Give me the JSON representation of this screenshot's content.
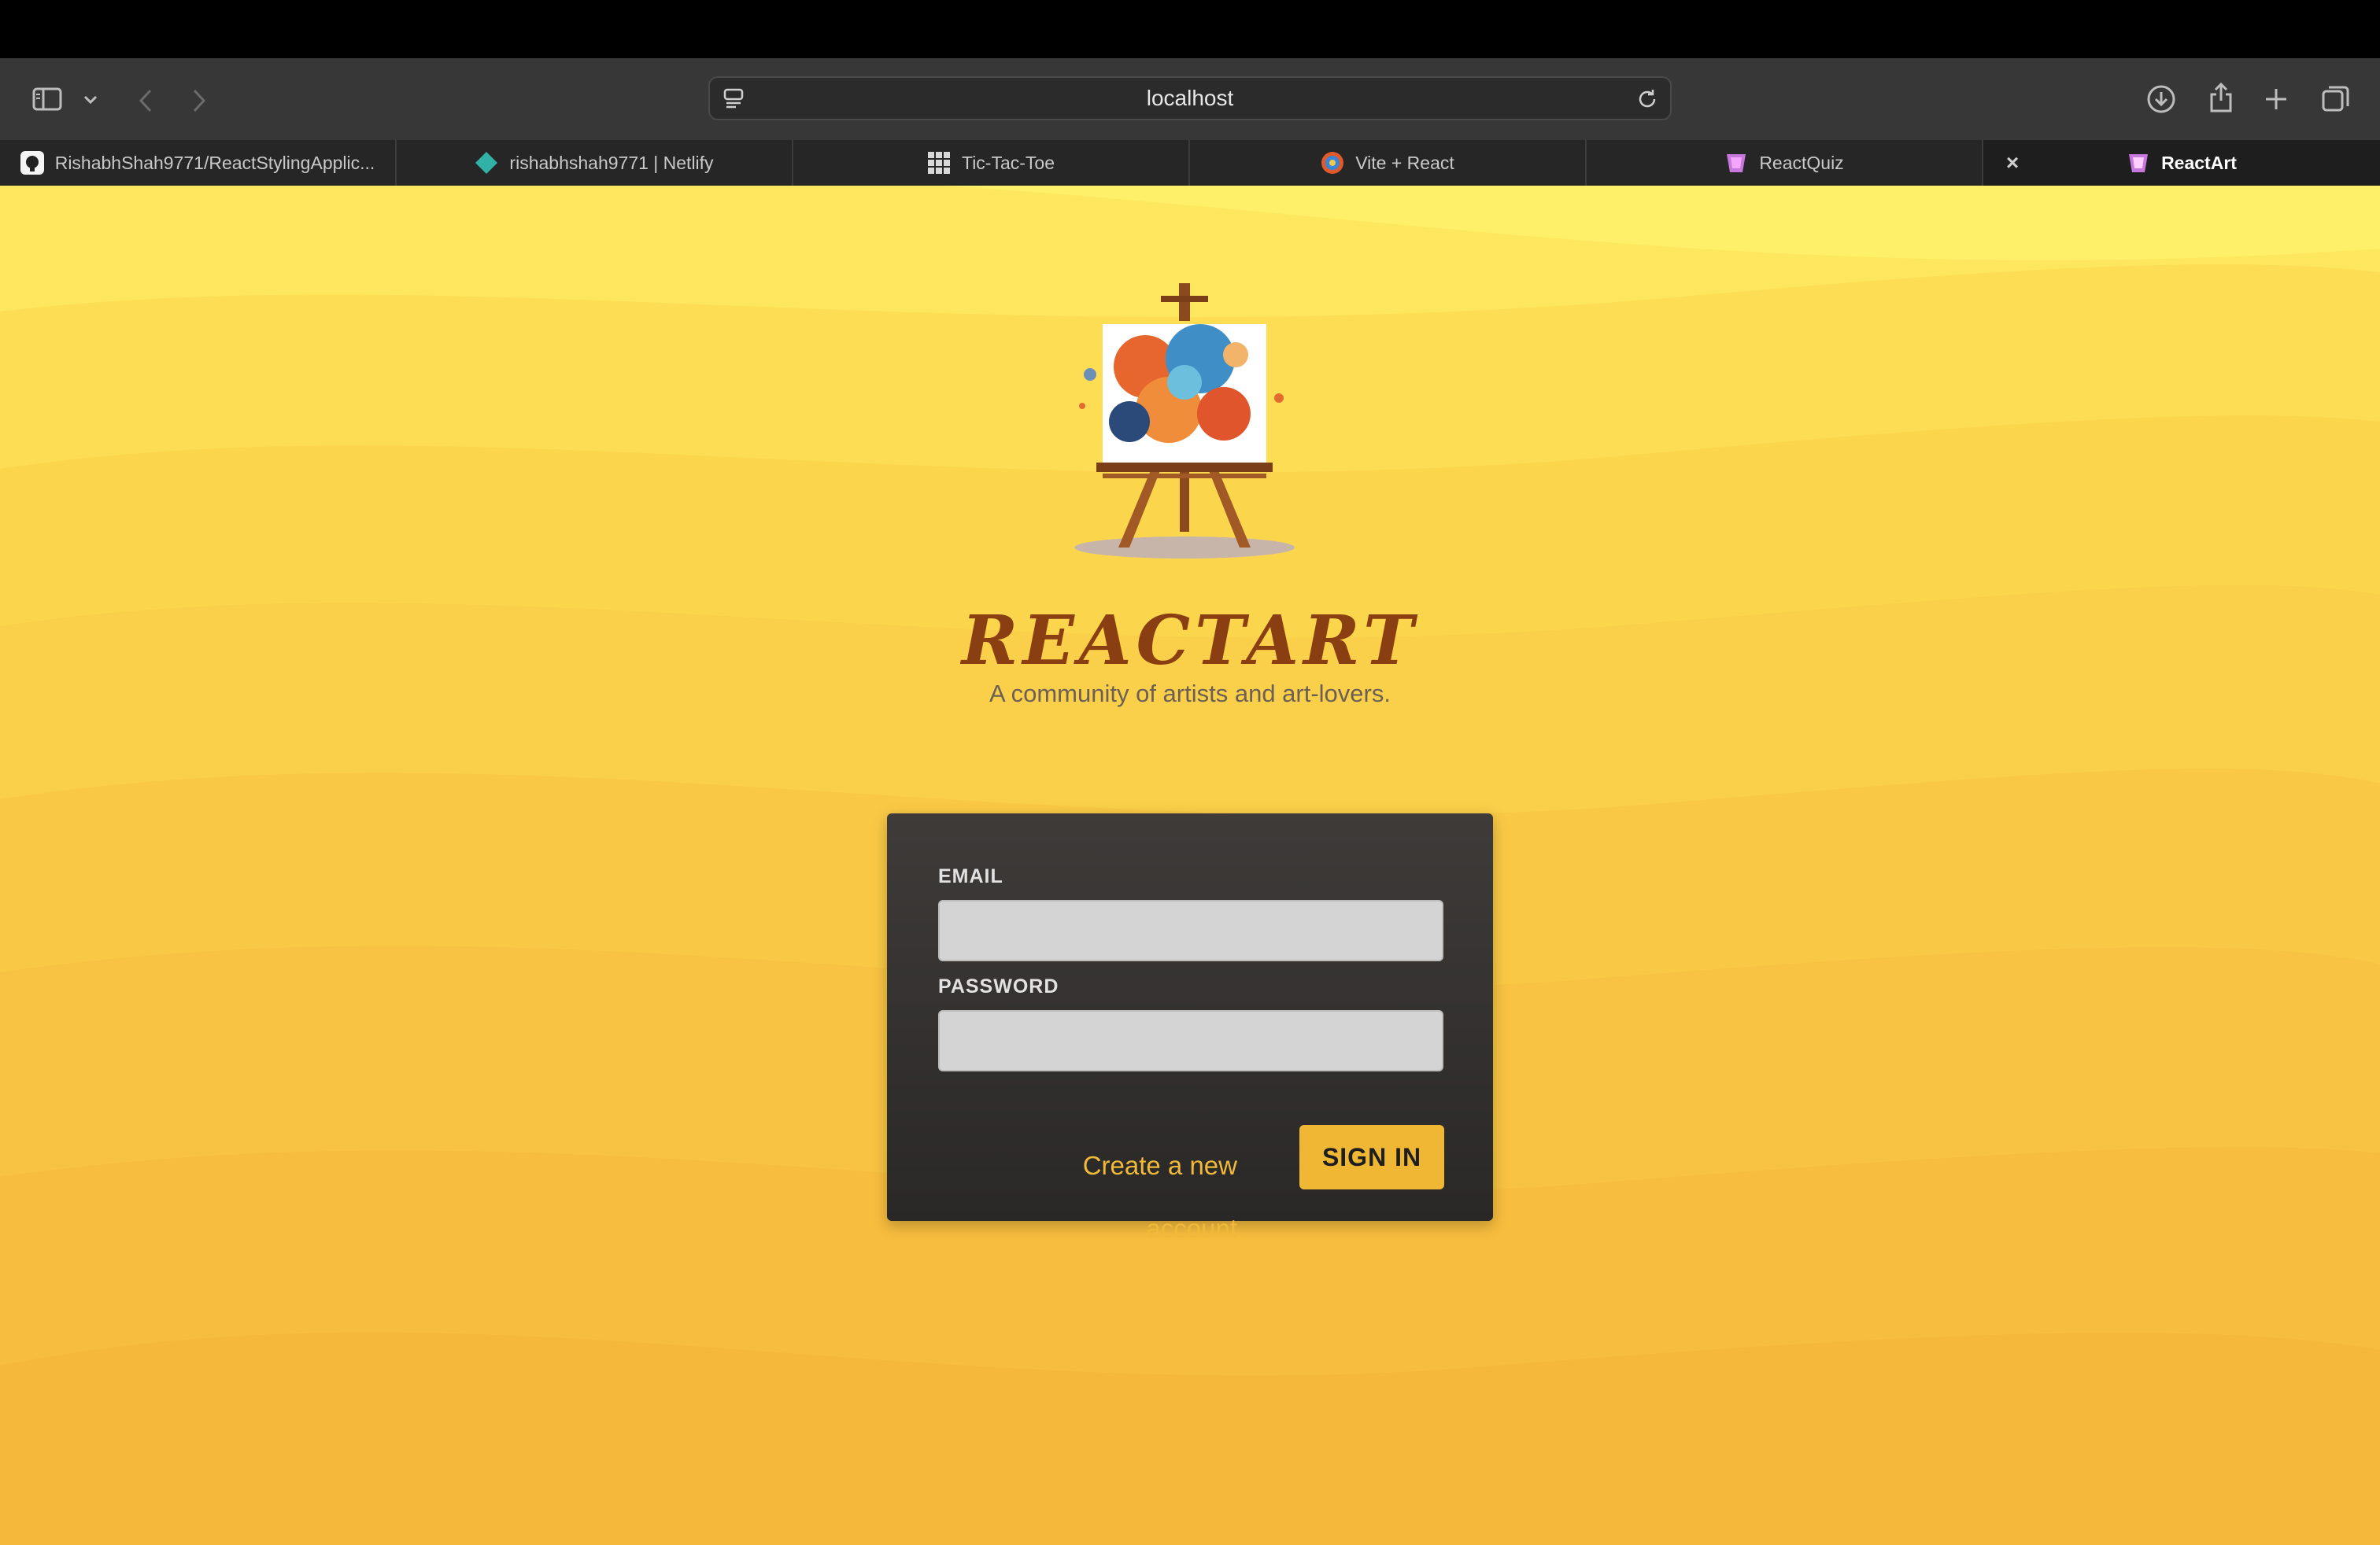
{
  "browser": {
    "address": "localhost",
    "tabs": [
      {
        "label": "RishabhShah9771/ReactStylingApplic...",
        "icon": "github-icon"
      },
      {
        "label": "rishabhshah9771 | Netlify",
        "icon": "netlify-icon"
      },
      {
        "label": "Tic-Tac-Toe",
        "icon": "grid-icon"
      },
      {
        "label": "Vite + React",
        "icon": "react-logo-icon"
      },
      {
        "label": "ReactQuiz",
        "icon": "quiz-logo-icon"
      },
      {
        "label": "ReactArt",
        "icon": "reactart-logo-icon",
        "active": true
      }
    ],
    "colors": {
      "chrome": "#373737",
      "tabbar": "#262626"
    }
  },
  "header": {
    "title": "ReactArt",
    "tagline": "A community of artists and art-lovers."
  },
  "login": {
    "email_label": "Email",
    "email_value": "",
    "password_label": "Password",
    "password_value": "",
    "create_account": "Create a new account",
    "sign_in": "Sign In"
  },
  "colors": {
    "background_top": "#fff36e",
    "background_bottom": "#f6b83a",
    "title": "#8a3f12",
    "card": "#2f2d2c",
    "accent": "#f0b735"
  }
}
